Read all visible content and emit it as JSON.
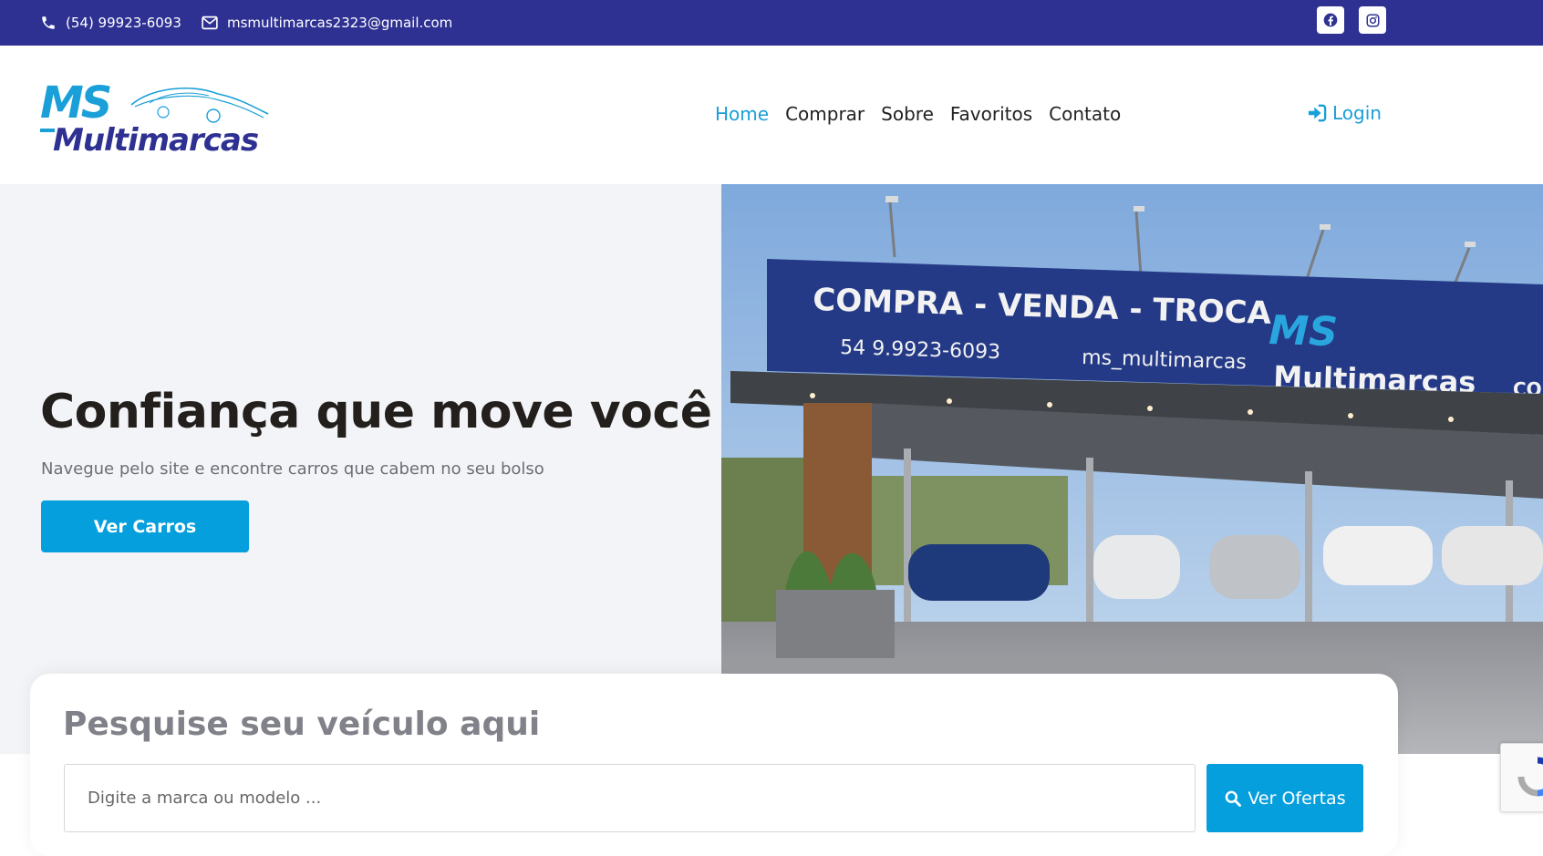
{
  "topbar": {
    "phone": "(54) 99923-6093",
    "email": "msmultimarcas2323@gmail.com",
    "icons": [
      "phone-icon",
      "envelope-icon",
      "facebook-icon",
      "instagram-icon"
    ]
  },
  "logo": {
    "line1": "MS",
    "line2": "Multimarcas"
  },
  "nav": {
    "items": [
      "Home",
      "Comprar",
      "Sobre",
      "Favoritos",
      "Contato"
    ],
    "active": "Home",
    "login": "Login"
  },
  "hero": {
    "title": "Confiança que move você",
    "subtitle": "Navegue pelo site e encontre carros que cabem no seu bolso",
    "button": "Ver Carros"
  },
  "photo": {
    "sign_headline": "COMPRA - VENDA - TROCA",
    "sign_phone": "54 9.9923-6093",
    "sign_instagram": "ms_multimarcas",
    "sign_brand1": "MS",
    "sign_brand2": "Multimarcas",
    "sign_cut": "COMI"
  },
  "search": {
    "title": "Pesquise seu veículo aqui",
    "placeholder": "Digite a marca ou modelo ...",
    "button": "Ver Ofertas"
  },
  "colors": {
    "topbar": "#2e3192",
    "accent": "#069fdd",
    "nav_active": "#1a9fd8",
    "title": "#221f1c"
  }
}
